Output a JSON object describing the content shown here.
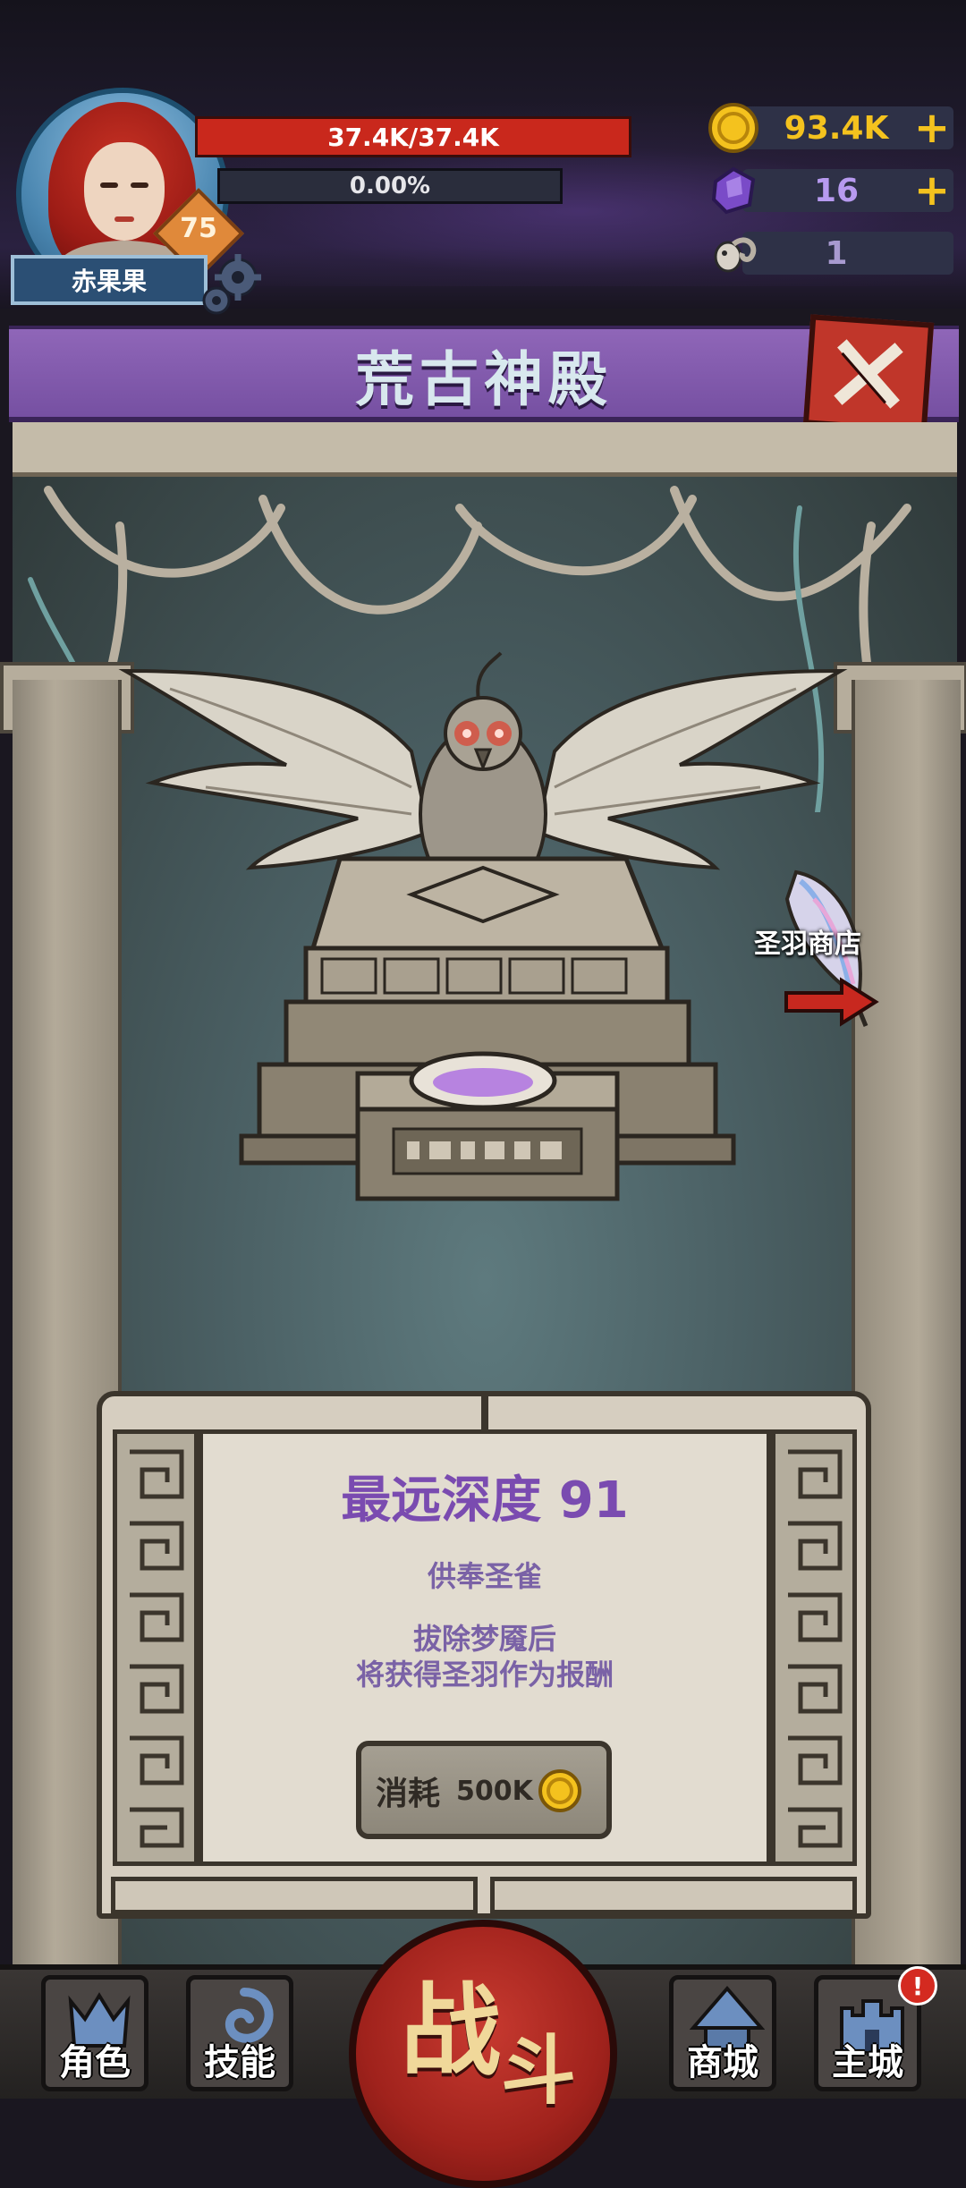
{
  "player": {
    "name": "赤果果",
    "level": "75",
    "hp": "37.4K/37.4K",
    "xp": "0.00%"
  },
  "resources": {
    "gold": "93.4K",
    "gems": "16",
    "skulls": "1"
  },
  "screen": {
    "title": "荒古神殿",
    "shop_label": "圣羽商店"
  },
  "panel": {
    "depth": "最远深度 91",
    "offer": "供奉圣雀",
    "desc_line1": "拔除梦魇后",
    "desc_line2": "将获得圣羽作为报酬",
    "cost_label": "消耗",
    "cost_value": "500K"
  },
  "nav": {
    "character": "角色",
    "skills": "技能",
    "fight_1": "战",
    "fight_2": "斗",
    "shop": "商城",
    "city": "主城",
    "alert": "!"
  },
  "colors": {
    "accent_purple": "#8f66b8",
    "hp_red": "#c9281c",
    "gold": "#f4c21e"
  }
}
